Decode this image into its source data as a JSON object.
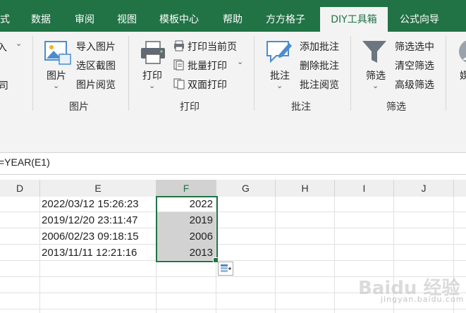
{
  "tabs": [
    "式",
    "数据",
    "审阅",
    "视图",
    "模板中心",
    "帮助",
    "方方格子",
    "DIY工具箱",
    "公式向导"
  ],
  "ribbon": {
    "partial_top": "入",
    "partial_mid": "司",
    "image_group": {
      "big_button": "图片",
      "items": [
        "导入图片",
        "选区截图",
        "图片阅览"
      ],
      "label": "图片"
    },
    "print_group": {
      "big_button": "打印",
      "items": [
        "打印当前页",
        "批量打印",
        "双面打印"
      ],
      "label": "打印"
    },
    "comment_group": {
      "big_button": "批注",
      "items": [
        "添加批注",
        "删除批注",
        "批注阅览"
      ],
      "label": "批注"
    },
    "filter_group": {
      "big_button": "筛选",
      "items": [
        "筛选选中",
        "清空筛选",
        "高级筛选"
      ],
      "label": "筛选"
    },
    "partial_right": "媒"
  },
  "formula": "=YEAR(E1)",
  "columns": [
    "D",
    "E",
    "F",
    "G",
    "H",
    "I",
    "J"
  ],
  "rows": [
    {
      "e": "2022/03/12 15:26:23",
      "f": "2022"
    },
    {
      "e": "2019/12/20 23:11:47",
      "f": "2019"
    },
    {
      "e": "2006/02/23 09:18:15",
      "f": "2006"
    },
    {
      "e": "2013/11/11 12:21:16",
      "f": "2013"
    }
  ],
  "watermark": {
    "main": "Baidu 经验",
    "sub": "jingyan.baidu.com"
  },
  "colors": {
    "accent": "#217346",
    "selection": "#d2d2d2"
  }
}
